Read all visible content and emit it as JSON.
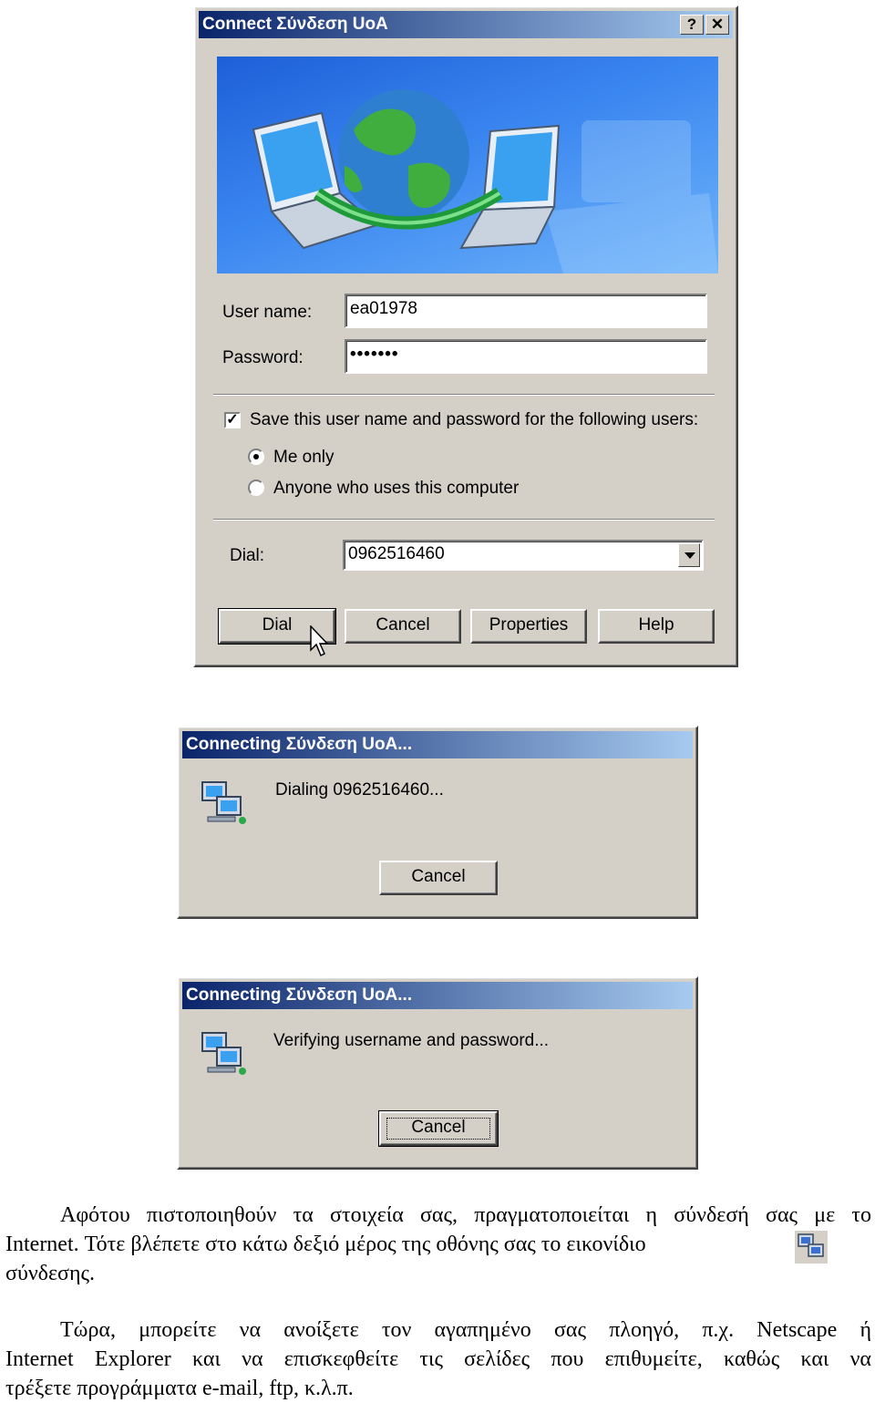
{
  "connect_dialog": {
    "title": "Connect Σύνδεση UoA",
    "help_glyph": "?",
    "close_glyph": "✕",
    "username_label": "User name:",
    "username_value": "ea01978",
    "password_label": "Password:",
    "password_value": "•••••••",
    "save_label": "Save this user name and password for the following users:",
    "save_checked": true,
    "radio_me_only": "Me only",
    "radio_anyone": "Anyone who uses this computer",
    "dial_label": "Dial:",
    "dial_value": "0962516460",
    "buttons": {
      "dial": "Dial",
      "cancel": "Cancel",
      "properties": "Properties",
      "help": "Help"
    },
    "banner_icons": [
      "laptop-icon",
      "globe-icon",
      "laptop-icon"
    ]
  },
  "connecting_1": {
    "title": "Connecting Σύνδεση UoA...",
    "status": "Dialing 0962516460...",
    "cancel": "Cancel",
    "icon": "network-connection-icon"
  },
  "connecting_2": {
    "title": "Connecting Σύνδεση UoA...",
    "status": "Verifying username and password...",
    "cancel": "Cancel",
    "icon": "network-connection-icon"
  },
  "text": {
    "p1_line1": "Αφότου πιστοποιηθούν τα στοιχεία σας, πραγματοποιείται η σύνδεσή σας με το",
    "p1_line2": "Internet. Τότε βλέπετε στο κάτω δεξιό μέρος της οθόνης σας το εικονίδιο",
    "p1_line3": "σύνδεσης.",
    "p2_line1": "Τώρα, μπορείτε να ανοίξετε τον αγαπημένο σας πλοηγό, π.χ. Netscape ή",
    "p2_line2": "Internet Explorer και να επισκεφθείτε τις σελίδες που επιθυμείτε, καθώς και να",
    "p2_line3": "τρέξετε προγράμματα e-mail, ftp, κ.λ.π.",
    "tray_icon": "network-tray-icon"
  }
}
